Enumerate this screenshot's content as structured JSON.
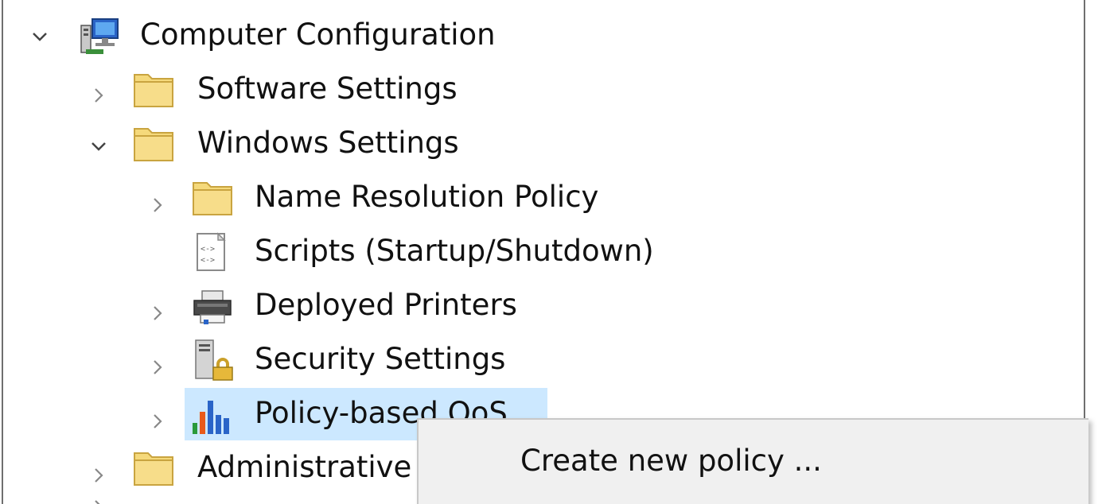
{
  "tree": {
    "root": {
      "label": "Computer Configuration",
      "icon": "computer-icon",
      "expanded": true
    },
    "items": [
      {
        "label": "Software Settings",
        "icon": "folder-icon",
        "expanded": false
      },
      {
        "label": "Windows Settings",
        "icon": "folder-icon",
        "expanded": true
      },
      {
        "label": "Name Resolution Policy",
        "icon": "folder-icon",
        "expanded": false
      },
      {
        "label": "Scripts (Startup/Shutdown)",
        "icon": "script-icon",
        "expanded": null
      },
      {
        "label": "Deployed Printers",
        "icon": "printer-icon",
        "expanded": false
      },
      {
        "label": "Security Settings",
        "icon": "security-settings-icon",
        "expanded": false
      },
      {
        "label": "Policy-based QoS",
        "icon": "qos-chart-icon",
        "expanded": false,
        "selected": true
      },
      {
        "label": "Administrative Templates",
        "icon": "folder-icon",
        "expanded": false
      }
    ]
  },
  "context_menu": {
    "items": [
      {
        "label": "Create new policy ..."
      }
    ]
  },
  "colors": {
    "selection": "#cce8ff",
    "menu_background": "#f0f0f0",
    "folder": "#f5d97b",
    "text": "#111111"
  }
}
